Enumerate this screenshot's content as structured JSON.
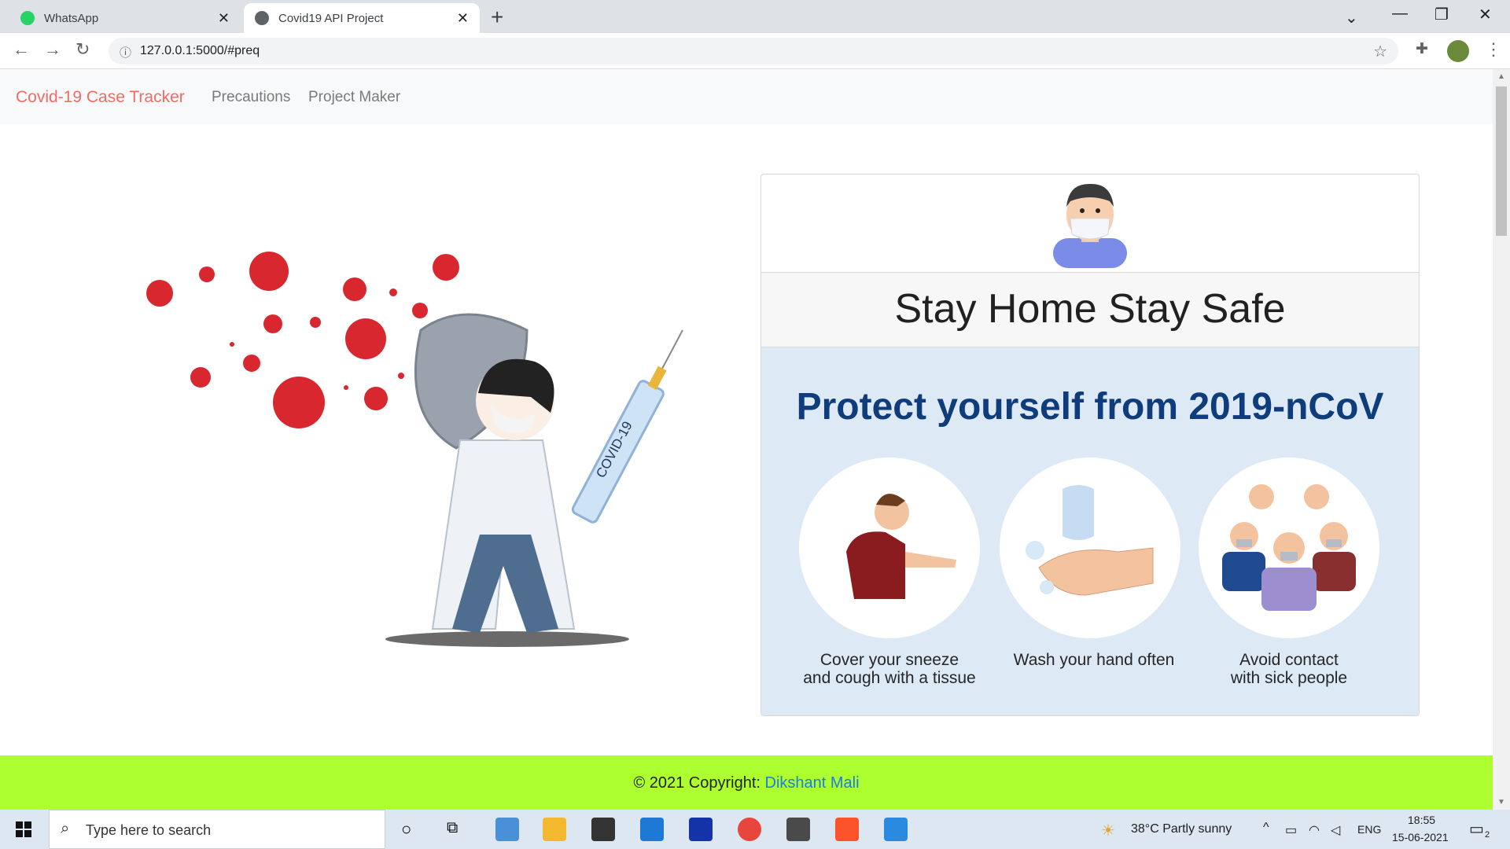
{
  "browser": {
    "tabs": [
      {
        "title": "WhatsApp",
        "favicon_color": "#25d366",
        "active": false
      },
      {
        "title": "Covid19 API Project",
        "favicon_color": "#5f6368",
        "active": true
      }
    ],
    "url": "127.0.0.1:5000/#preq"
  },
  "navbar": {
    "brand": "Covid-19 Case Tracker",
    "links": [
      "Precautions",
      "Project Maker"
    ]
  },
  "card": {
    "title": "Stay Home Stay Safe",
    "poster_title": "Protect yourself from 2019-nCoV",
    "tips": [
      {
        "line1": "Cover your sneeze",
        "line2": "and cough with a tissue"
      },
      {
        "line1": "Wash your hand often",
        "line2": ""
      },
      {
        "line1": "Avoid contact",
        "line2": "with sick people"
      }
    ]
  },
  "illustration": {
    "syringe_label": "COVID-19"
  },
  "footer": {
    "copyright_prefix": "© 2021 Copyright: ",
    "author": "Dikshant Mali",
    "background": "#adff2f"
  },
  "taskbar": {
    "search_placeholder": "Type here to search",
    "weather": "38°C  Partly sunny",
    "language": "ENG",
    "time": "18:55",
    "date": "15-06-2021",
    "notification_count": "2"
  }
}
